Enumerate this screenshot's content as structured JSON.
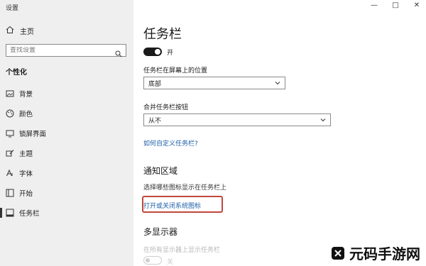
{
  "app": {
    "title": "设置",
    "window_controls": {
      "minimize": "—",
      "maximize": "□",
      "close": "✕"
    }
  },
  "sidebar": {
    "home_label": "主页",
    "search_placeholder": "查找设置",
    "section_label": "个性化",
    "items": [
      {
        "label": "背景",
        "icon": "image-icon",
        "active": false
      },
      {
        "label": "颜色",
        "icon": "palette-icon",
        "active": false
      },
      {
        "label": "锁屏界面",
        "icon": "lock-screen-icon",
        "active": false
      },
      {
        "label": "主题",
        "icon": "brush-icon",
        "active": false
      },
      {
        "label": "字体",
        "icon": "font-icon",
        "active": false
      },
      {
        "label": "开始",
        "icon": "start-menu-icon",
        "active": false
      },
      {
        "label": "任务栏",
        "icon": "taskbar-icon",
        "active": true
      }
    ]
  },
  "main": {
    "page_title": "任务栏",
    "top_toggle_state": "开",
    "position": {
      "label": "任务栏在屏幕上的位置",
      "value": "底部"
    },
    "combine": {
      "label": "合并任务栏按钮",
      "value": "从不"
    },
    "customize_link": "如何自定义任务栏?",
    "notification": {
      "heading": "通知区域",
      "desc": "选择哪些图标显示在任务栏上",
      "system_icons_link": "打开或关闭系统图标"
    },
    "multi_display": {
      "heading": "多显示器",
      "desc": "在所有显示器上显示任务栏",
      "toggle_state": "关"
    }
  },
  "watermark": {
    "text": "元码手游网"
  },
  "colors": {
    "highlight": "#c1473b",
    "link": "#1d5fa6",
    "sidebar_bg": "#efefef"
  }
}
